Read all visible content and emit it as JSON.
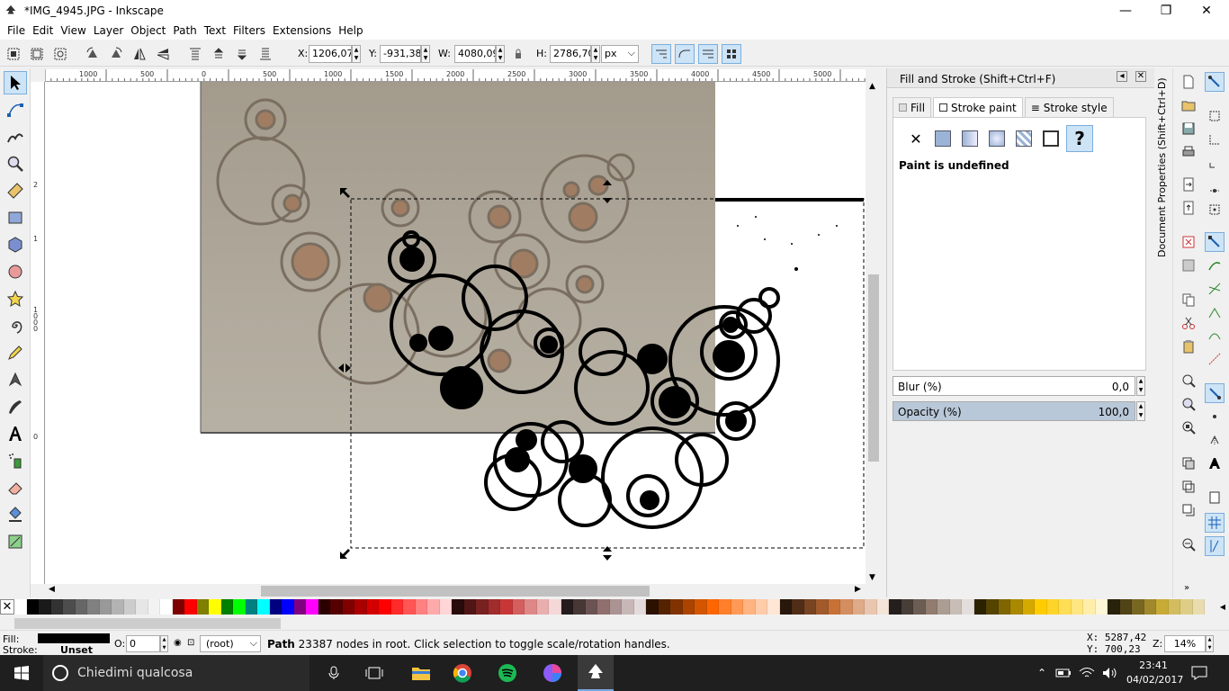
{
  "window": {
    "title": "*IMG_4945.JPG - Inkscape",
    "minimize": "—",
    "maximize": "❐",
    "close": "✕"
  },
  "menu": [
    "File",
    "Edit",
    "View",
    "Layer",
    "Object",
    "Path",
    "Text",
    "Filters",
    "Extensions",
    "Help"
  ],
  "toolcontrols": {
    "x_label": "X:",
    "x_value": "1206,07",
    "y_label": "Y:",
    "y_value": "-931,38",
    "w_label": "W:",
    "w_value": "4080,09",
    "h_label": "H:",
    "h_value": "2786,70",
    "unit": "px"
  },
  "ruler": {
    "h_labels": [
      "1000",
      "500",
      "0",
      "500",
      "1000",
      "1500",
      "2000",
      "2500",
      "3000",
      "3500",
      "4000",
      "4500",
      "5000"
    ],
    "v_labels": [
      "2",
      "1",
      "1000",
      "0"
    ]
  },
  "dock": {
    "title": "Fill and Stroke (Shift+Ctrl+F)",
    "tabs": [
      {
        "label": "Fill"
      },
      {
        "label": "Stroke paint"
      },
      {
        "label": "Stroke style"
      }
    ],
    "paint_status": "Paint is undefined",
    "blur_label": "Blur (%)",
    "blur_value": "0,0",
    "opacity_label": "Opacity (%)",
    "opacity_value": "100,0",
    "opacity_fraction": 1.0,
    "side_tab": "Document Properties (Shift+Ctrl+D)"
  },
  "status": {
    "fill_label": "Fill:",
    "stroke_label": "Stroke:",
    "stroke_value": "Unset",
    "opacity_label": "O:",
    "opacity_value": "0",
    "layer": "(root)",
    "message_bold": "Path",
    "message": " 23387 nodes in root. Click selection to toggle scale/rotation handles.",
    "x_coord": "X: 5287,42",
    "y_coord": "Y:  700,23",
    "zoom_label": "Z:",
    "zoom_value": "14%"
  },
  "taskbar": {
    "search_placeholder": "Chiedimi qualcosa",
    "time": "23:41",
    "date": "04/02/2017"
  },
  "palette": [
    "#ffffff",
    "#000000",
    "#1a1a1a",
    "#333333",
    "#4d4d4d",
    "#666666",
    "#808080",
    "#999999",
    "#b3b3b3",
    "#cccccc",
    "#e6e6e6",
    "#f2f2f2",
    "#ffffff",
    "#800000",
    "#ff0000",
    "#808000",
    "#ffff00",
    "#008000",
    "#00ff00",
    "#008080",
    "#00ffff",
    "#000080",
    "#0000ff",
    "#800080",
    "#ff00ff",
    "#2b0000",
    "#550000",
    "#800000",
    "#aa0000",
    "#d40000",
    "#ff0000",
    "#ff2a2a",
    "#ff5555",
    "#ff8080",
    "#ffaaaa",
    "#ffd5d5",
    "#280b0b",
    "#501616",
    "#782121",
    "#a02c2c",
    "#c83737",
    "#d35f5f",
    "#de8787",
    "#e9afaf",
    "#f4d7d7",
    "#241c1c",
    "#483737",
    "#6c5353",
    "#916f6f",
    "#ac9393",
    "#c8b7b7",
    "#e3dbdb",
    "#2b1100",
    "#552200",
    "#803300",
    "#aa4400",
    "#d45500",
    "#ff6600",
    "#ff7f2a",
    "#ff9955",
    "#ffb380",
    "#ffccaa",
    "#ffe6d5",
    "#28170b",
    "#502d16",
    "#784421",
    "#a05a2c",
    "#c87137",
    "#d38d5f",
    "#deaa87",
    "#e9c6af",
    "#f4e3d7",
    "#241f1c",
    "#483e37",
    "#6c5d53",
    "#917c6f",
    "#ac9d93",
    "#c8beb7",
    "#e3dedb",
    "#2b2200",
    "#554400",
    "#806600",
    "#aa8800",
    "#d4aa00",
    "#ffcc00",
    "#ffd42a",
    "#ffdd55",
    "#ffe680",
    "#ffeeaa",
    "#fff6d5",
    "#28220b",
    "#504416",
    "#786721",
    "#a0892c",
    "#c8ab37",
    "#d3bc5f",
    "#decd87",
    "#e9ddaf"
  ]
}
